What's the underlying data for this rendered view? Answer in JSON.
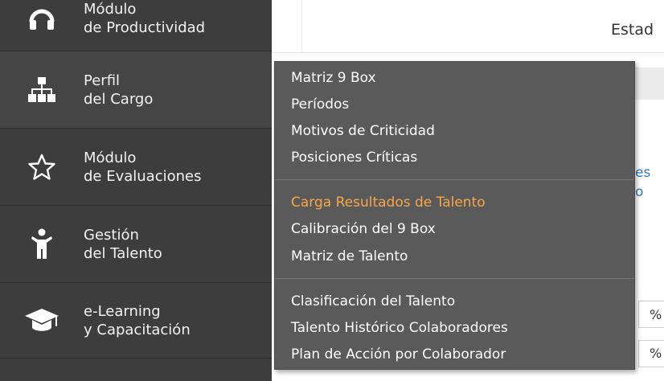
{
  "sidebar": {
    "items": [
      {
        "line1": "Módulo",
        "line2": "de Productividad",
        "icon": "headset-icon"
      },
      {
        "line1": "Perfil",
        "line2": "del Cargo",
        "icon": "org-chart-icon"
      },
      {
        "line1": "Módulo",
        "line2": "de Evaluaciones",
        "icon": "star-icon"
      },
      {
        "line1": "Gestión",
        "line2": "del Talento",
        "icon": "person-icon"
      },
      {
        "line1": "e-Learning",
        "line2": "y Capacitación",
        "icon": "graduation-cap-icon"
      }
    ]
  },
  "main": {
    "estado_label": "Estad",
    "links_partial": [
      "es",
      "o"
    ],
    "percent_symbol": "%"
  },
  "dropdown": {
    "group1": [
      "Matriz 9 Box",
      "Períodos",
      "Motivos de Criticidad",
      "Posiciones Críticas"
    ],
    "group2": [
      "Carga Resultados de Talento",
      "Calibración del 9 Box",
      "Matriz de Talento"
    ],
    "group3": [
      "Clasificación del Talento",
      "Talento Histórico Colaboradores",
      "Plan de Acción por Colaborador"
    ],
    "highlight_color": "#f7a64a"
  }
}
